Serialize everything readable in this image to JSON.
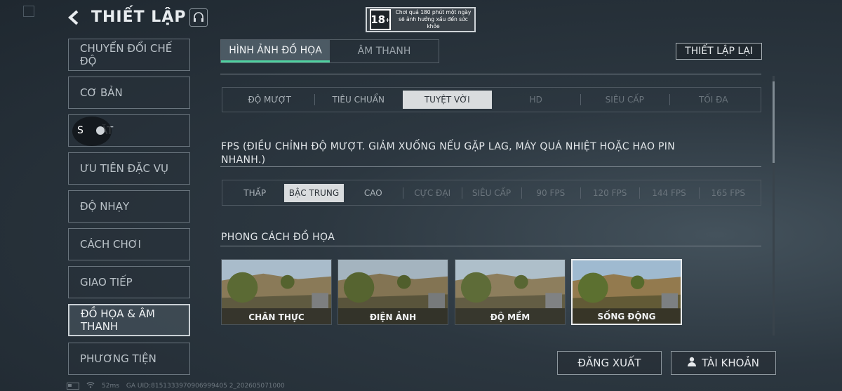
{
  "header": {
    "title": "THIẾT LẬP",
    "age_rating": "18",
    "age_rating_plus": "+",
    "age_notice": "Chơi quá 180 phút một ngày sẽ ảnh hưởng xấu đến sức khỏe"
  },
  "sidebar": {
    "items": [
      {
        "label": "CHUYỂN ĐỔI CHẾ ĐỘ",
        "active": false
      },
      {
        "label": "CƠ BẢN",
        "active": false
      },
      {
        "label": "ĂT",
        "active": false
      },
      {
        "label": "ƯU TIÊN ĐẶC VỤ",
        "active": false
      },
      {
        "label": "ĐỘ NHẠY",
        "active": false
      },
      {
        "label": "CÁCH CHƠI",
        "active": false
      },
      {
        "label": "GIAO TIẾP",
        "active": false
      },
      {
        "label": "ĐỒ HỌA & ÂM THANH",
        "active": true
      },
      {
        "label": "PHƯƠNG TIỆN",
        "active": false
      }
    ],
    "cursor_letter": "S"
  },
  "tabs": [
    {
      "label": "HÌNH ẢNH ĐỒ HỌA",
      "active": true
    },
    {
      "label": "ÂM THANH",
      "active": false
    }
  ],
  "reset_label": "THIẾT LẬP LẠI",
  "quality": {
    "options": [
      "ĐỘ MƯỢT",
      "TIÊU CHUẨN",
      "TUYỆT VỜI",
      "HD",
      "SIÊU CẤP",
      "TỐI ĐA"
    ],
    "selected": "TUYỆT VỜI",
    "disabled": [
      "HD",
      "SIÊU CẤP",
      "TỐI ĐA"
    ]
  },
  "fps": {
    "label_line1": "FPS (ĐIỀU CHỈNH ĐỘ MƯỢT. GIẢM XUỐNG NẾU GẶP LAG, MÁY QUÁ NHIỆT HOẶC HAO PIN",
    "label_line2": "NHANH.)",
    "options": [
      "THẤP",
      "BẬC TRUNG",
      "CAO",
      "CỰC ĐẠI",
      "SIÊU CẤP",
      "90 FPS",
      "120 FPS",
      "144 FPS",
      "165 FPS"
    ],
    "selected": "BẬC TRUNG",
    "disabled": [
      "CỰC ĐẠI",
      "SIÊU CẤP",
      "90 FPS",
      "120 FPS",
      "144 FPS",
      "165 FPS"
    ]
  },
  "graphic_style": {
    "label": "PHONG CÁCH ĐỒ HỌA",
    "options": [
      "CHÂN THỰC",
      "ĐIỆN ẢNH",
      "ĐỘ MỀM",
      "SỐNG ĐỘNG"
    ],
    "selected": "SỐNG ĐỘNG"
  },
  "footer": {
    "logout_label": "ĐĂNG XUẤT",
    "account_label": "TÀI KHOẢN",
    "ping": "52ms",
    "uid": "GA UID:8151333970906999405 2_202605071000"
  },
  "colors": {
    "accent": "#4fd1a0",
    "selected_segment": "#d9dcde"
  }
}
